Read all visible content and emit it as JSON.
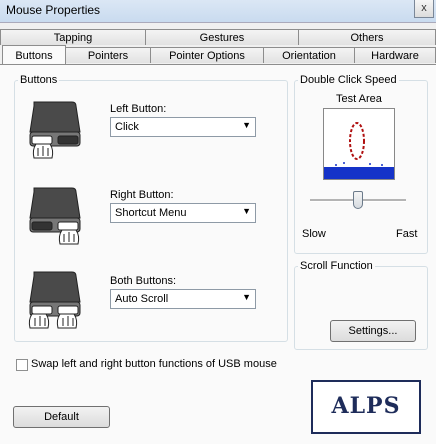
{
  "window": {
    "title": "Mouse Properties",
    "close_glyph": "x"
  },
  "tabs_top": [
    {
      "label": "Tapping"
    },
    {
      "label": "Gestures"
    },
    {
      "label": "Others"
    }
  ],
  "tabs_bottom": [
    {
      "label": "Buttons",
      "active": true
    },
    {
      "label": "Pointers"
    },
    {
      "label": "Pointer Options"
    },
    {
      "label": "Orientation"
    },
    {
      "label": "Hardware"
    }
  ],
  "buttons_group": {
    "title": "Buttons",
    "left": {
      "label": "Left Button:",
      "value": "Click"
    },
    "right": {
      "label": "Right Button:",
      "value": "Shortcut Menu"
    },
    "both": {
      "label": "Both Buttons:",
      "value": "Auto Scroll"
    }
  },
  "double_click": {
    "title": "Double Click Speed",
    "test_area_label": "Test Area",
    "slow_label": "Slow",
    "fast_label": "Fast",
    "speed": 0.5
  },
  "scroll_function": {
    "title": "Scroll Function",
    "settings_label": "Settings..."
  },
  "swap_checkbox": {
    "label": "Swap left and right button functions of USB mouse",
    "checked": false
  },
  "default_button": {
    "label": "Default"
  },
  "logo_text": "ALPS"
}
